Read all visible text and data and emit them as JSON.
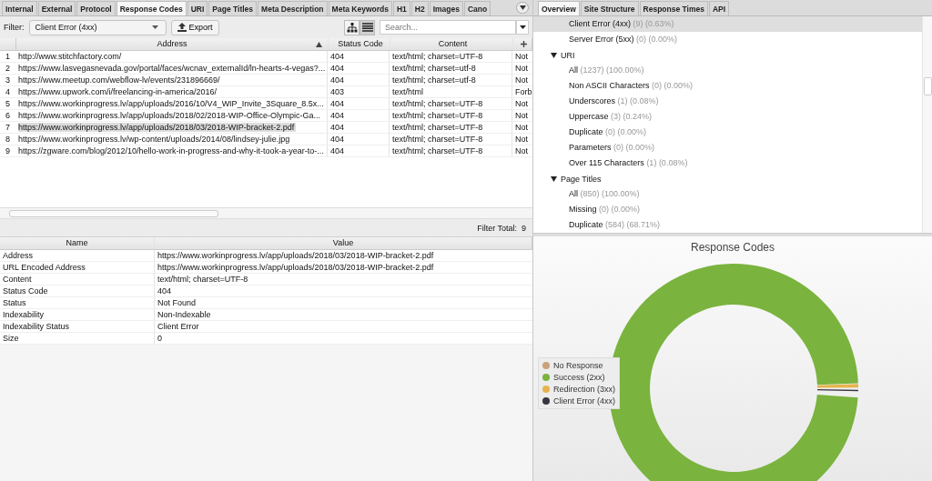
{
  "left_tabs": [
    {
      "label": "Internal",
      "selected": false
    },
    {
      "label": "External",
      "selected": false
    },
    {
      "label": "Protocol",
      "selected": false
    },
    {
      "label": "Response Codes",
      "selected": true
    },
    {
      "label": "URI",
      "selected": false
    },
    {
      "label": "Page Titles",
      "selected": false
    },
    {
      "label": "Meta Description",
      "selected": false
    },
    {
      "label": "Meta Keywords",
      "selected": false
    },
    {
      "label": "H1",
      "selected": false
    },
    {
      "label": "H2",
      "selected": false
    },
    {
      "label": "Images",
      "selected": false
    },
    {
      "label": "Cano",
      "selected": false
    }
  ],
  "filter": {
    "label": "Filter:",
    "value": "Client Error (4xx)"
  },
  "export_button": "Export",
  "search": {
    "placeholder": "Search..."
  },
  "view_toggle": {
    "tree_selected": false
  },
  "table": {
    "columns": [
      "Address",
      "Status Code",
      "Content"
    ],
    "rows": [
      {
        "index": "1",
        "address": "http://www.stitchfactory.com/",
        "status_code": "404",
        "content": "text/html; charset=UTF-8",
        "column_5": "Not",
        "selected": false
      },
      {
        "index": "2",
        "address": "https://www.lasvegasnevada.gov/portal/faces/wcnav_externalId/ln-hearts-4-vegas?...",
        "status_code": "404",
        "content": "text/html; charset=utf-8",
        "column_5": "Not",
        "selected": false
      },
      {
        "index": "3",
        "address": "https://www.meetup.com/webflow-lv/events/231896669/",
        "status_code": "404",
        "content": "text/html; charset=utf-8",
        "column_5": "Not",
        "selected": false
      },
      {
        "index": "4",
        "address": "https://www.upwork.com/i/freelancing-in-america/2016/",
        "status_code": "403",
        "content": "text/html",
        "column_5": "Forb",
        "selected": false
      },
      {
        "index": "5",
        "address": "https://www.workinprogress.lv/app/uploads/2016/10/V4_WIP_Invite_3Square_8.5x...",
        "status_code": "404",
        "content": "text/html; charset=UTF-8",
        "column_5": "Not",
        "selected": false
      },
      {
        "index": "6",
        "address": "https://www.workinprogress.lv/app/uploads/2018/02/2018-WIP-Office-Olympic-Ga...",
        "status_code": "404",
        "content": "text/html; charset=UTF-8",
        "column_5": "Not",
        "selected": false
      },
      {
        "index": "7",
        "address": "https://www.workinprogress.lv/app/uploads/2018/03/2018-WIP-bracket-2.pdf",
        "status_code": "404",
        "content": "text/html; charset=UTF-8",
        "column_5": "Not",
        "selected": true
      },
      {
        "index": "8",
        "address": "https://www.workinprogress.lv/wp-content/uploads/2014/08/lindsey-julie.jpg",
        "status_code": "404",
        "content": "text/html; charset=UTF-8",
        "column_5": "Not",
        "selected": false
      },
      {
        "index": "9",
        "address": "https://zgware.com/blog/2012/10/hello-work-in-progress-and-why-it-took-a-year-to-...",
        "status_code": "404",
        "content": "text/html; charset=UTF-8",
        "column_5": "Not",
        "selected": false
      }
    ]
  },
  "filter_total": {
    "label": "Filter Total:",
    "value": "9"
  },
  "details": {
    "columns": [
      "Name",
      "Value"
    ],
    "rows": [
      {
        "name": "Address",
        "value": "https://www.workinprogress.lv/app/uploads/2018/03/2018-WIP-bracket-2.pdf"
      },
      {
        "name": "URL Encoded Address",
        "value": "https://www.workinprogress.lv/app/uploads/2018/03/2018-WIP-bracket-2.pdf"
      },
      {
        "name": "Content",
        "value": "text/html; charset=UTF-8"
      },
      {
        "name": "Status Code",
        "value": "404"
      },
      {
        "name": "Status",
        "value": "Not Found"
      },
      {
        "name": "Indexability",
        "value": "Non-Indexable"
      },
      {
        "name": "Indexability Status",
        "value": "Client Error"
      },
      {
        "name": "Size",
        "value": "0"
      }
    ]
  },
  "right_tabs": [
    {
      "label": "Overview",
      "selected": true
    },
    {
      "label": "Site Structure",
      "selected": false
    },
    {
      "label": "Response Times",
      "selected": false
    },
    {
      "label": "API",
      "selected": false
    }
  ],
  "tree": [
    {
      "children": [
        {
          "label": "Client Error (4xx)",
          "count": "(9)",
          "percent": "(0.63%)",
          "selected": true
        },
        {
          "label": "Server Error (5xx)",
          "count": "(0)",
          "percent": "(0.00%)",
          "selected": false
        }
      ]
    },
    {
      "label": "URI",
      "expanded": true,
      "children": [
        {
          "label": "All",
          "count": "(1237)",
          "percent": "(100.00%)",
          "selected": false
        },
        {
          "label": "Non ASCII Characters",
          "count": "(0)",
          "percent": "(0.00%)",
          "selected": false
        },
        {
          "label": "Underscores",
          "count": "(1)",
          "percent": "(0.08%)",
          "selected": false
        },
        {
          "label": "Uppercase",
          "count": "(3)",
          "percent": "(0.24%)",
          "selected": false
        },
        {
          "label": "Duplicate",
          "count": "(0)",
          "percent": "(0.00%)",
          "selected": false
        },
        {
          "label": "Parameters",
          "count": "(0)",
          "percent": "(0.00%)",
          "selected": false
        },
        {
          "label": "Over 115 Characters",
          "count": "(1)",
          "percent": "(0.08%)",
          "selected": false
        }
      ]
    },
    {
      "label": "Page Titles",
      "expanded": true,
      "children": [
        {
          "label": "All",
          "count": "(850)",
          "percent": "(100.00%)",
          "selected": false
        },
        {
          "label": "Missing",
          "count": "(0)",
          "percent": "(0.00%)",
          "selected": false
        },
        {
          "label": "Duplicate",
          "count": "(584)",
          "percent": "(68.71%)",
          "selected": false
        }
      ]
    }
  ],
  "chart": {
    "title": "Response Codes",
    "legend": [
      {
        "label": "No Response",
        "color": "#c9a27a"
      },
      {
        "label": "Success (2xx)",
        "color": "#7ab33e"
      },
      {
        "label": "Redirection (3xx)",
        "color": "#e6b44c"
      },
      {
        "label": "Client Error (4xx)",
        "color": "#3b3540"
      }
    ]
  }
}
